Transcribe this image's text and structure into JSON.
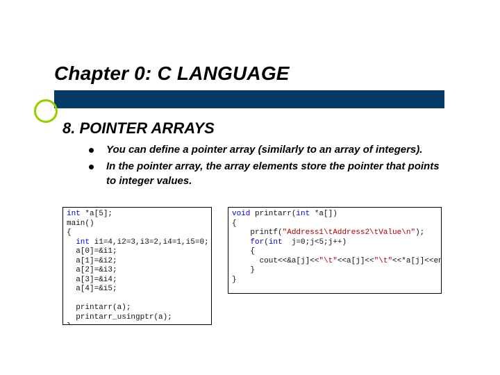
{
  "title": "Chapter 0: C LANGUAGE",
  "subtitle": "8. POINTER ARRAYS",
  "bullets": [
    "You can define a pointer array (similarly to an array of integers).",
    "In the pointer array, the array elements store the pointer that points to integer values."
  ],
  "code_left": [
    [
      [
        "kw",
        "int"
      ],
      [
        "plain",
        " *a[5];"
      ]
    ],
    [
      [
        "plain",
        "main()"
      ]
    ],
    [
      [
        "plain",
        "{"
      ]
    ],
    [
      [
        "plain",
        "  "
      ],
      [
        "kw",
        "int"
      ],
      [
        "plain",
        " i1=4,i2=3,i3=2,i4=1,i5=0;"
      ]
    ],
    [
      [
        "plain",
        "  a[0]=&i1;"
      ]
    ],
    [
      [
        "plain",
        "  a[1]=&i2;"
      ]
    ],
    [
      [
        "plain",
        "  a[2]=&i3;"
      ]
    ],
    [
      [
        "plain",
        "  a[3]=&i4;"
      ]
    ],
    [
      [
        "plain",
        "  a[4]=&i5;"
      ]
    ],
    [
      [
        "plain",
        " "
      ]
    ],
    [
      [
        "plain",
        "  printarr(a);"
      ]
    ],
    [
      [
        "plain",
        "  printarr_usingptr(a);"
      ]
    ],
    [
      [
        "plain",
        "}"
      ]
    ]
  ],
  "code_right": [
    [
      [
        "kw",
        "void"
      ],
      [
        "plain",
        " printarr("
      ],
      [
        "kw",
        "int"
      ],
      [
        "plain",
        " *a[])"
      ]
    ],
    [
      [
        "plain",
        "{"
      ]
    ],
    [
      [
        "plain",
        "    printf("
      ],
      [
        "str",
        "\"Address1\\tAddress2\\tValue\\n\""
      ],
      [
        "plain",
        ");"
      ]
    ],
    [
      [
        "plain",
        "    "
      ],
      [
        "kw",
        "for"
      ],
      [
        "plain",
        "("
      ],
      [
        "kw",
        "int"
      ],
      [
        "plain",
        "  j=0;j<5;j++)"
      ]
    ],
    [
      [
        "plain",
        "    {"
      ]
    ],
    [
      [
        "plain",
        "      cout<<&a[j]<<"
      ],
      [
        "str",
        "\"\\t\""
      ],
      [
        "plain",
        "<<a[j]<<"
      ],
      [
        "str",
        "\"\\t\""
      ],
      [
        "plain",
        "<<*a[j]<<endl;"
      ]
    ],
    [
      [
        "plain",
        "    }"
      ]
    ],
    [
      [
        "plain",
        "}"
      ]
    ]
  ]
}
